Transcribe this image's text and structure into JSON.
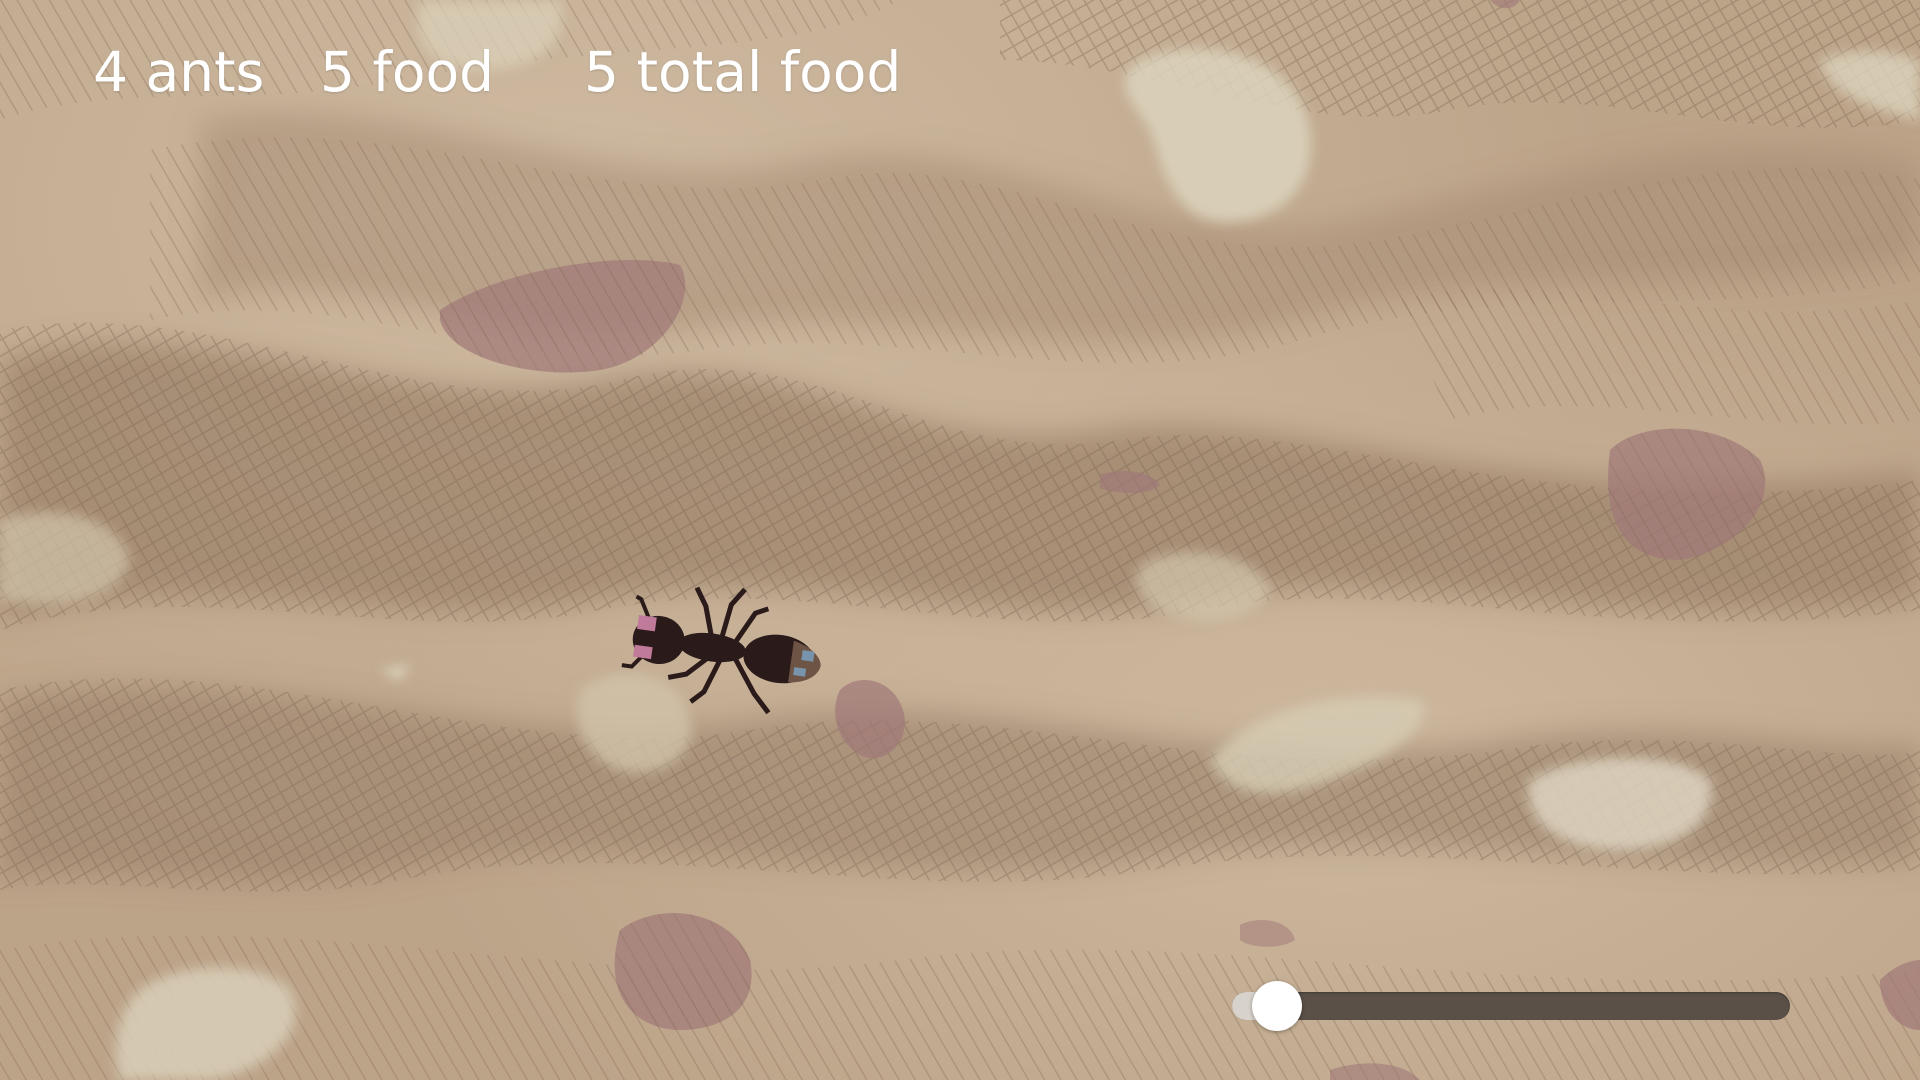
{
  "hud": {
    "ants_label": "4 ants",
    "food_label": "5 food",
    "total_food_label": "5 total food"
  },
  "speed_slider": {
    "value_fraction": 0.08
  },
  "colors": {
    "sand_base": "#bca489",
    "sand_light": "#d9ccb4",
    "sand_dark": "#8e7560",
    "pebble": "#a07878",
    "ant_body": "#2a1a1a",
    "ant_head_mark": "#c07a9a",
    "ant_tail_mark": "#7aa0c0"
  }
}
